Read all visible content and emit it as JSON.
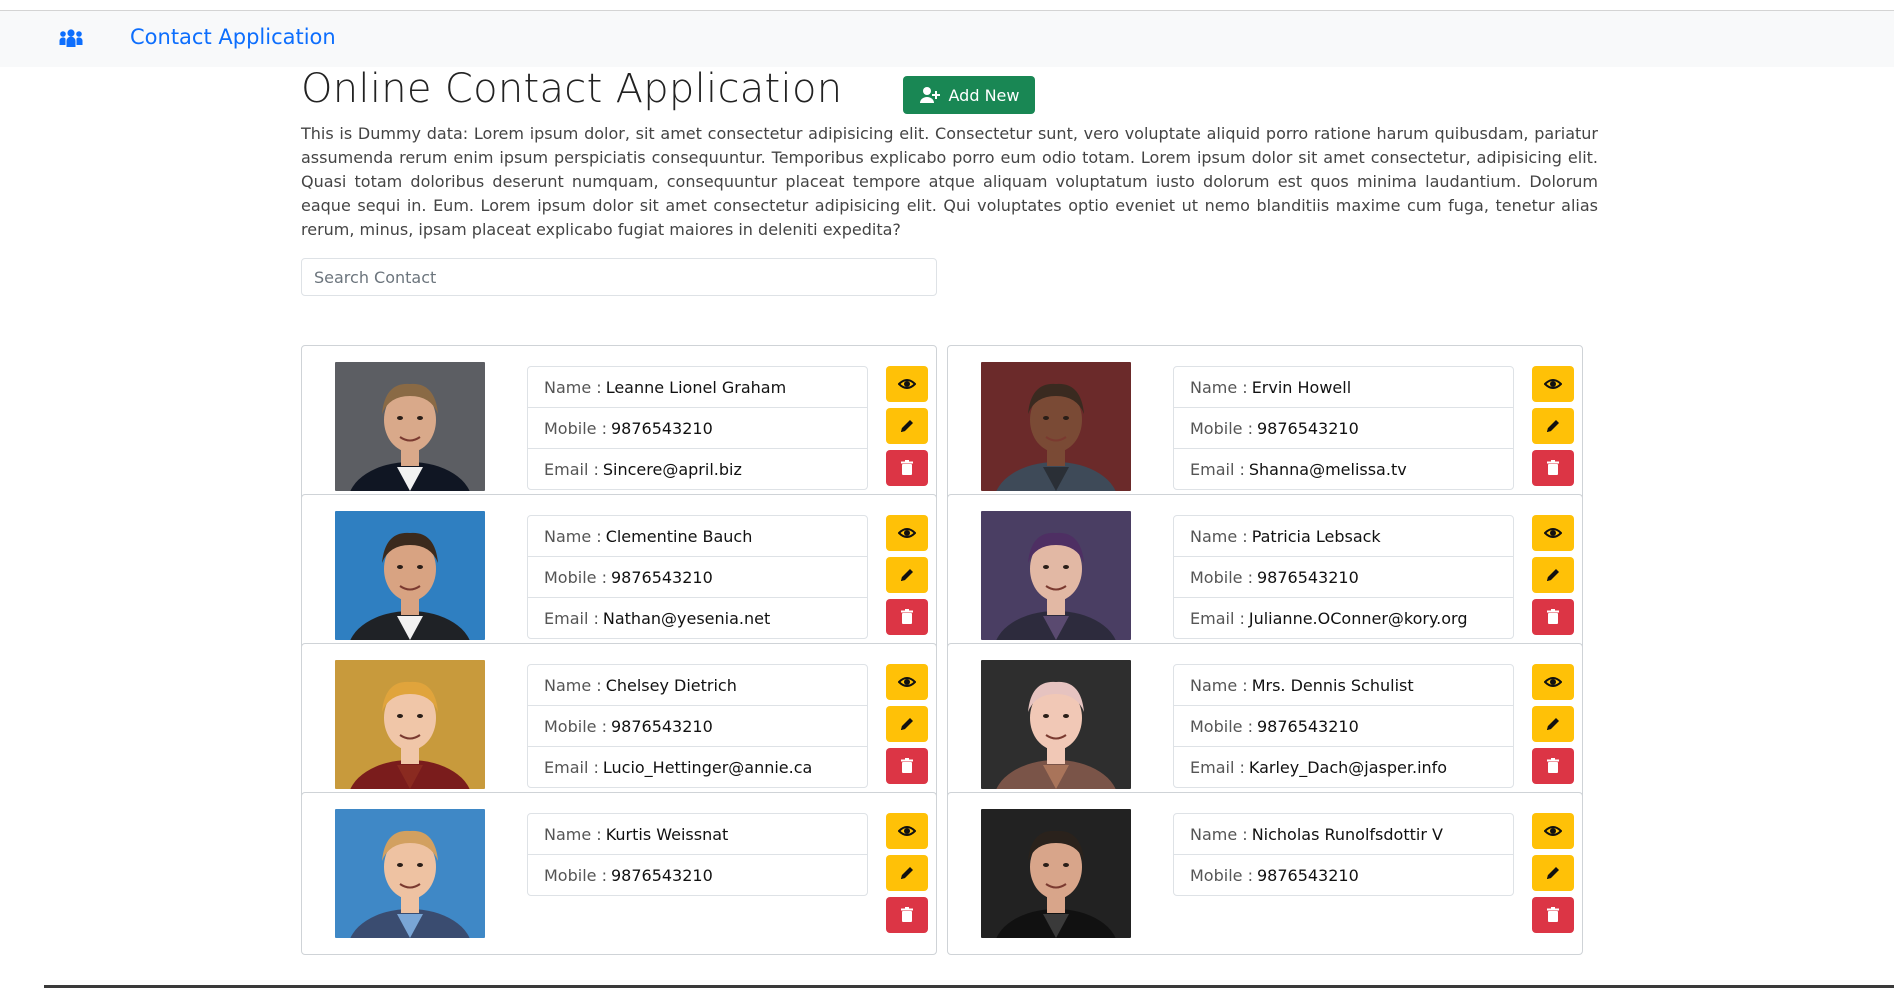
{
  "navbar": {
    "brand": "Contact Application",
    "icon": "users-icon"
  },
  "header": {
    "title": "Online Contact Application",
    "add_button": "Add New",
    "add_icon": "user-plus-icon"
  },
  "description": "This is Dummy data: Lorem ipsum dolor, sit amet consectetur adipisicing elit. Consectetur sunt, vero voluptate aliquid porro ratione harum quibusdam, pariatur assumenda rerum enim ipsum perspiciatis consequuntur. Temporibus explicabo porro eum odio totam. Lorem ipsum dolor sit amet consectetur, adipisicing elit. Quasi totam doloribus deserunt numquam, consequuntur placeat tempore atque aliquam voluptatum iusto dolorum est quos minima laudantium. Dolorum eaque sequi in. Eum. Lorem ipsum dolor sit amet consectetur adipisicing elit. Qui voluptates optio eveniet ut nemo blanditiis maxime cum fuga, tenetur alias rerum, minus, ipsam placeat explicabo fugiat maiores in deleniti expedita?",
  "search": {
    "placeholder": "Search Contact",
    "value": ""
  },
  "labels": {
    "name": "Name :",
    "mobile": "Mobile :",
    "email": "Email :"
  },
  "colors": {
    "brand": "#0d6efd",
    "success": "#198754",
    "warning": "#ffc107",
    "danger": "#dc3545"
  },
  "contacts": [
    {
      "name": "Leanne Lionel Graham",
      "mobile": "9876543210",
      "email": "Sincere@april.biz"
    },
    {
      "name": "Ervin Howell",
      "mobile": "9876543210",
      "email": "Shanna@melissa.tv"
    },
    {
      "name": "Clementine Bauch",
      "mobile": "9876543210",
      "email": "Nathan@yesenia.net"
    },
    {
      "name": "Patricia Lebsack",
      "mobile": "9876543210",
      "email": "Julianne.OConner@kory.org"
    },
    {
      "name": "Chelsey Dietrich",
      "mobile": "9876543210",
      "email": "Lucio_Hettinger@annie.ca"
    },
    {
      "name": "Mrs. Dennis Schulist",
      "mobile": "9876543210",
      "email": "Karley_Dach@jasper.info"
    },
    {
      "name": "Kurtis Weissnat",
      "mobile": "9876543210"
    },
    {
      "name": "Nicholas Runolfsdottir V",
      "mobile": "9876543210"
    }
  ]
}
